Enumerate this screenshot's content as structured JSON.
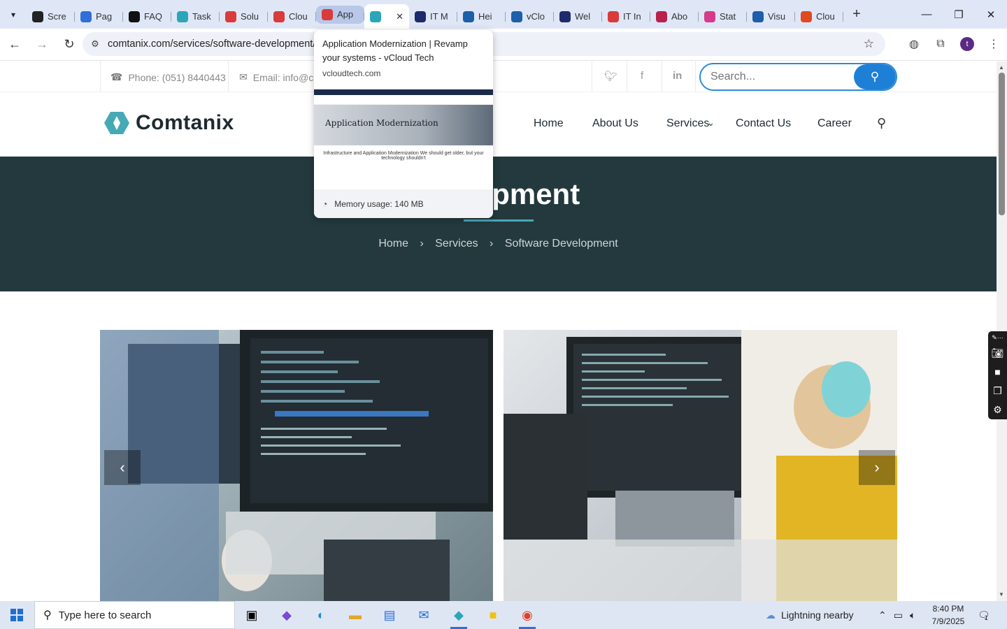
{
  "browser": {
    "tabs": [
      {
        "label": "Scre",
        "color": "#222222"
      },
      {
        "label": "Pag",
        "color": "#2f6fd6"
      },
      {
        "label": "FAQ",
        "color": "#111111"
      },
      {
        "label": "Task",
        "color": "#2aa6b8"
      },
      {
        "label": "Solu",
        "color": "#d93a3a"
      },
      {
        "label": "Clou",
        "color": "#d93a3a"
      },
      {
        "label": "App",
        "color": "#d93a3a"
      },
      {
        "label": "",
        "color": "#2aa6b8"
      },
      {
        "label": "IT M",
        "color": "#1d2a6b"
      },
      {
        "label": "Hei",
        "color": "#1d5fa8"
      },
      {
        "label": "vClo",
        "color": "#1d5fa8"
      },
      {
        "label": "Wel",
        "color": "#1d2a6b"
      },
      {
        "label": "IT In",
        "color": "#d93a3a"
      },
      {
        "label": "Abo",
        "color": "#b8214a"
      },
      {
        "label": "Stat",
        "color": "#d63a8a"
      },
      {
        "label": "Visu",
        "color": "#1d5fa8"
      },
      {
        "label": "Clou",
        "color": "#e04a1f"
      }
    ],
    "address": "comtanix.com/services/software-development/",
    "avatar_letter": "t"
  },
  "hovercard": {
    "title": "Application Modernization | Revamp your systems - vCloud Tech",
    "domain": "vcloudtech.com",
    "preview_heading": "Application Modernization",
    "preview_text": "Infrastructure and Application Modernization We should get older, but your technology shouldn't",
    "memory": "Memory usage: 140 MB"
  },
  "site": {
    "phone": "Phone: (051) 8440443",
    "email": "Email: info@c",
    "search_placeholder": "Search...",
    "brand": "Comtanix",
    "nav": [
      "Home",
      "About Us",
      "Services",
      "Contact Us",
      "Career"
    ],
    "hero_title": "evelopment",
    "breadcrumb": [
      "Home",
      "Services",
      "Software Development"
    ],
    "colors": {
      "hero_bg": "#23393d",
      "accent": "#1d7fd6",
      "teal": "#4aa7b8"
    }
  },
  "taskbar": {
    "search_placeholder": "Type here to search",
    "weather": "Lightning nearby",
    "time": "8:40 PM",
    "date": "7/9/2025",
    "notifications": "1"
  }
}
